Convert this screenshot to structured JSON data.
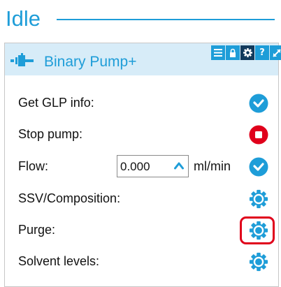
{
  "status": {
    "title": "Idle"
  },
  "module": {
    "name": "Binary Pump+",
    "icon": "pump-module-icon",
    "toolbar": [
      {
        "name": "menu-icon",
        "active": false
      },
      {
        "name": "lock-icon",
        "active": false
      },
      {
        "name": "gear-icon",
        "active": true
      },
      {
        "name": "help-icon",
        "label": "?",
        "active": false
      },
      {
        "name": "expand-icon",
        "active": false
      }
    ]
  },
  "rows": {
    "glp": {
      "label": "Get GLP info:",
      "action_icon": "execute-icon"
    },
    "stop": {
      "label": "Stop pump:",
      "action_icon": "stop-icon"
    },
    "flow": {
      "label": "Flow:",
      "value": "0.000",
      "unit": "ml/min",
      "action_icon": "execute-icon"
    },
    "ssv": {
      "label": "SSV/Composition:",
      "action_icon": "settings-gear-icon"
    },
    "purge": {
      "label": "Purge:",
      "action_icon": "settings-gear-icon",
      "highlighted": true
    },
    "solvent": {
      "label": "Solvent levels:",
      "action_icon": "settings-gear-icon"
    }
  },
  "colors": {
    "accent": "#1e9dd8",
    "header_bg": "#d7ecf8",
    "stop": "#e0001b",
    "highlight_border": "#e0001b",
    "toolbar_active": "#113a5c"
  }
}
